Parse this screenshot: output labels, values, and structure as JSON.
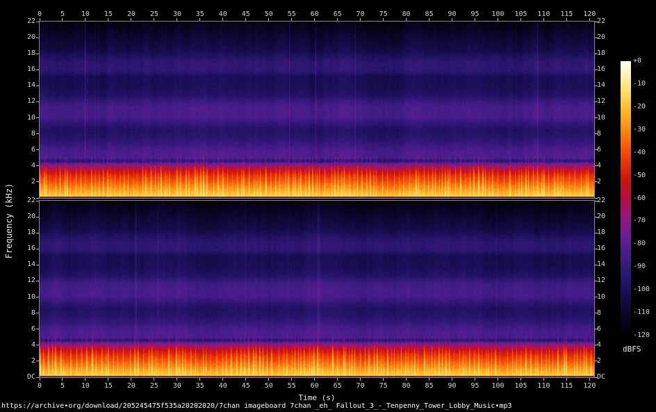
{
  "figure": {
    "url_caption": "https://archive•org/download/205245475f535a20202020/7chan imageboard 7chan _eh_ Fallout_3_-_Tenpenny_Tower_Lobby_Music•mp3",
    "x_axis_title": "Time (s)",
    "y_axis_title": "Frequency (kHz)",
    "colorbar_title": "dBFS",
    "background": "#000000"
  },
  "layout_colors": {
    "frame": "#8a8a8a",
    "tick_mark": "#b4b4b4",
    "tick_text": "#d4d4d4",
    "title_text": "#ececec",
    "url_text": "#ffffff"
  },
  "chart_data": {
    "type": "heatmap",
    "subtype": "audio-spectrogram",
    "title": "https://archive•org/download/205245475f535a20202020/7chan imageboard 7chan _eh_ Fallout_3_-_Tenpenny_Tower_Lobby_Music•mp3",
    "channels": 2,
    "channel_layout": "two stacked spectrogram panels (stereo channels), nearly identical content",
    "x_axis": {
      "label": "Time (s)",
      "min": 0,
      "max": 121,
      "tick_values": [
        0,
        5,
        10,
        15,
        20,
        25,
        30,
        35,
        40,
        45,
        50,
        55,
        60,
        65,
        70,
        75,
        80,
        85,
        90,
        95,
        100,
        105,
        110,
        115,
        120
      ],
      "tick_labels": [
        "0",
        "5",
        "10",
        "15",
        "20",
        "25",
        "30",
        "35",
        "40",
        "45",
        "50",
        "55",
        "60",
        "65",
        "70",
        "75",
        "80",
        "85",
        "90",
        "95",
        "100",
        "105",
        "110",
        "115",
        "120"
      ]
    },
    "y_axis": {
      "label": "Frequency (kHz)",
      "min_khz": 0,
      "max_khz": 22,
      "tick_labels_top_to_bottom": [
        "22",
        "20",
        "18",
        "16",
        "14",
        "12",
        "10",
        "8",
        "6",
        "4",
        "2",
        "DC"
      ],
      "labels_on_both_sides": true
    },
    "z_axis": {
      "label": "dBFS",
      "min": -120,
      "max": 0,
      "tick_labels": [
        "+0",
        "-10",
        "-20",
        "-30",
        "-40",
        "-50",
        "-60",
        "-70",
        "-80",
        "-90",
        "-100",
        "-110",
        "-120"
      ],
      "colorbar_position": "right"
    },
    "palette_stops_db_hex": [
      [
        0,
        "#fffff2"
      ],
      [
        -6,
        "#fff3b0"
      ],
      [
        -13,
        "#ffe060"
      ],
      [
        -20,
        "#ffc030"
      ],
      [
        -28,
        "#ff9418"
      ],
      [
        -36,
        "#fb6208"
      ],
      [
        -44,
        "#e93404"
      ],
      [
        -52,
        "#d01408"
      ],
      [
        -60,
        "#b80d45"
      ],
      [
        -68,
        "#98157f"
      ],
      [
        -76,
        "#6f1d96"
      ],
      [
        -84,
        "#4a1d8c"
      ],
      [
        -92,
        "#2f1875"
      ],
      [
        -100,
        "#1c105c"
      ],
      [
        -106,
        "#120a40"
      ],
      [
        -112,
        "#090522"
      ],
      [
        -117,
        "#030210"
      ],
      [
        -120,
        "#000000"
      ]
    ],
    "freq_profile_db": [
      [
        0,
        -16
      ],
      [
        0.3,
        -18
      ],
      [
        0.7,
        -23
      ],
      [
        1.3,
        -30
      ],
      [
        2.0,
        -38
      ],
      [
        2.7,
        -45
      ],
      [
        3.3,
        -53
      ],
      [
        3.9,
        -63
      ],
      [
        4.3,
        -78
      ],
      [
        4.65,
        -96
      ],
      [
        5.0,
        -84
      ],
      [
        5.6,
        -83
      ],
      [
        6.2,
        -86
      ],
      [
        6.9,
        -91
      ],
      [
        7.7,
        -96
      ],
      [
        8.6,
        -98
      ],
      [
        9.4,
        -92
      ],
      [
        10.1,
        -85
      ],
      [
        11.3,
        -85
      ],
      [
        12.0,
        -89
      ],
      [
        12.7,
        -97
      ],
      [
        13.7,
        -101
      ],
      [
        15.2,
        -102
      ],
      [
        15.9,
        -93
      ],
      [
        16.9,
        -93
      ],
      [
        17.6,
        -98
      ],
      [
        18.4,
        -104
      ],
      [
        19.4,
        -107
      ],
      [
        20.3,
        -110
      ],
      [
        21.0,
        -113
      ],
      [
        22,
        -116
      ]
    ],
    "transients": {
      "band_khz": 5.2,
      "amp_db_min": 9,
      "amp_db_max": 28,
      "crash_prob": 0.01,
      "note": "dense vertical percussion spikes below ~4.5 kHz reaching yellow/orange; occasional faint full-height columns"
    },
    "noise_db": 6,
    "clip_max_db": -13,
    "legend_position": "right colorbar",
    "grid": false
  }
}
